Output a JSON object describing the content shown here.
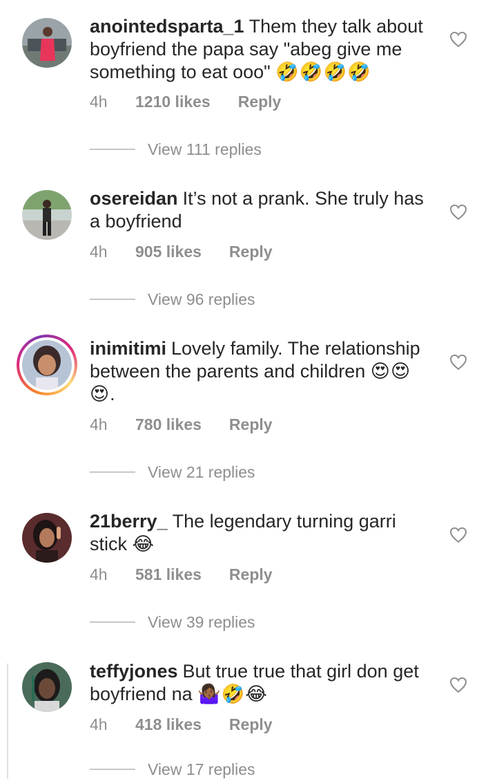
{
  "comments": [
    {
      "username": "anointedsparta_1",
      "text": "Them they talk about boyfriend the papa say \"abeg give me something to eat ooo\"",
      "emojis": "🤣🤣🤣🤣",
      "time": "4h",
      "likes": "1210 likes",
      "reply": "Reply",
      "view_replies": "View 111 replies"
    },
    {
      "username": "osereidan",
      "text": "It’s not a prank. She truly has a boyfriend",
      "emojis": "",
      "time": "4h",
      "likes": "905 likes",
      "reply": "Reply",
      "view_replies": "View 96 replies"
    },
    {
      "username": "inimitimi",
      "text": "Lovely family. The relationship between the parents and children",
      "emojis": "😍😍😍.",
      "time": "4h",
      "likes": "780 likes",
      "reply": "Reply",
      "view_replies": "View 21 replies"
    },
    {
      "username": "21berry_",
      "text": "The legendary turning garri stick",
      "emojis": "😂",
      "time": "4h",
      "likes": "581 likes",
      "reply": "Reply",
      "view_replies": "View 39 replies"
    },
    {
      "username": "teffyjones",
      "text": "But true true that girl don get boyfriend na",
      "emojis": "🤷🏾‍♀️🤣😂",
      "time": "4h",
      "likes": "418 likes",
      "reply": "Reply",
      "view_replies": "View 17 replies"
    }
  ],
  "icons": {
    "like": "heart-outline-icon"
  },
  "colors": {
    "text": "#262626",
    "secondary": "#8e8e8e",
    "story_ring_start": "#f58529",
    "story_ring_end": "#dd2a7b"
  }
}
